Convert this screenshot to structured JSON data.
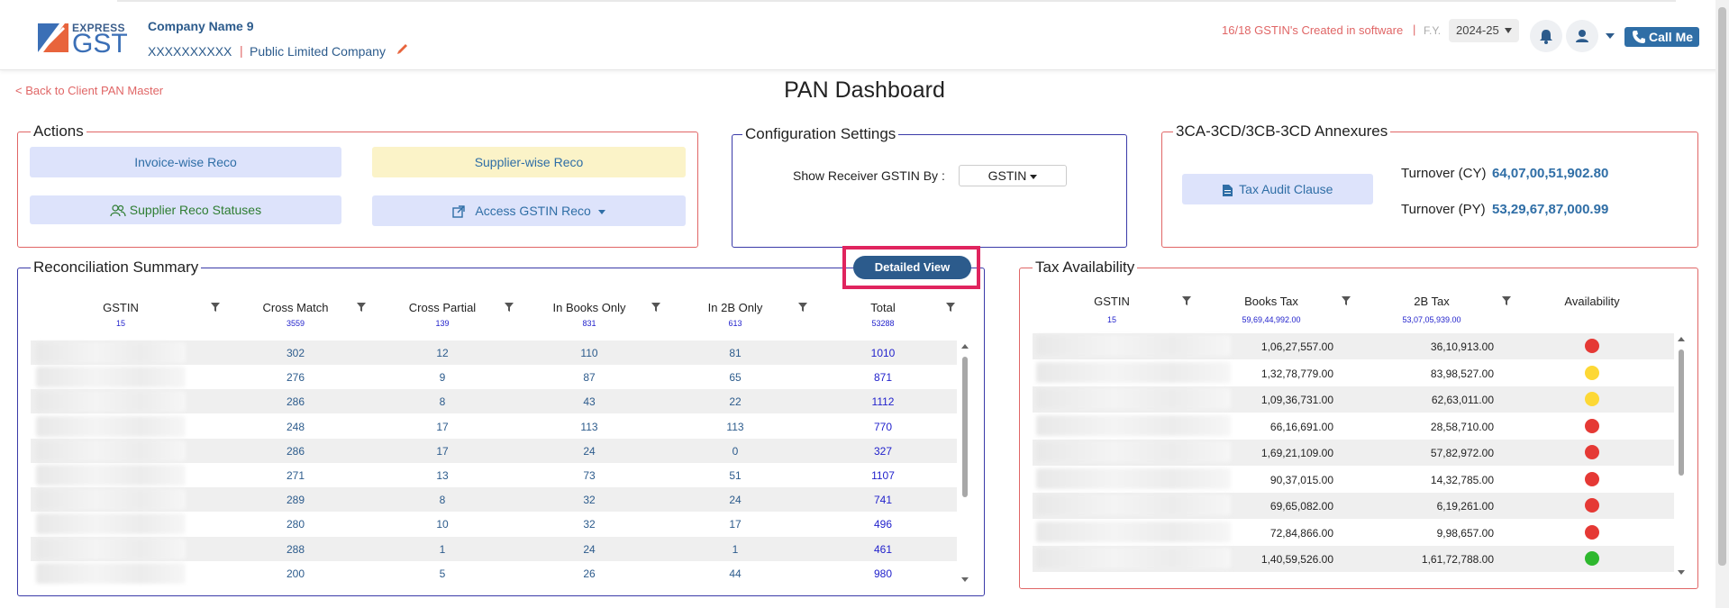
{
  "header": {
    "logo_top": "EXPRESS",
    "logo_bottom": "GST",
    "company_name": "Company Name 9",
    "pan": "XXXXXXXXXX",
    "separator": "|",
    "company_type": "Public Limited Company",
    "gstin_created": "16/18 GSTIN's Created in software",
    "fy_label": "F.Y.",
    "fy_value": "2024-25",
    "call_me": "Call Me"
  },
  "nav": {
    "back_link": "< Back to Client PAN Master",
    "page_title": "PAN Dashboard"
  },
  "actions": {
    "legend": "Actions",
    "invoice_reco": "Invoice-wise Reco",
    "supplier_reco": "Supplier-wise Reco",
    "supplier_statuses": "Supplier Reco Statuses",
    "access_gstin_reco": "Access GSTIN Reco"
  },
  "config": {
    "legend": "Configuration Settings",
    "label": "Show Receiver GSTIN By :",
    "value": "GSTIN"
  },
  "annexures": {
    "legend": "3CA-3CD/3CB-3CD Annexures",
    "tax_audit": "Tax Audit Clause",
    "turnover_cy_label": "Turnover (CY)",
    "turnover_cy": "64,07,00,51,902.80",
    "turnover_py_label": "Turnover (PY)",
    "turnover_py": "53,29,67,87,000.99"
  },
  "reco": {
    "legend": "Reconciliation Summary",
    "detailed_view": "Detailed View",
    "columns": [
      "GSTIN",
      "Cross Match",
      "Cross Partial",
      "In Books Only",
      "In 2B Only",
      "Total"
    ],
    "totals": [
      "15",
      "3559",
      "139",
      "831",
      "613",
      "53288"
    ],
    "rows": [
      [
        "302",
        "12",
        "110",
        "81",
        "1010"
      ],
      [
        "276",
        "9",
        "87",
        "65",
        "871"
      ],
      [
        "286",
        "8",
        "43",
        "22",
        "1112"
      ],
      [
        "248",
        "17",
        "113",
        "113",
        "770"
      ],
      [
        "286",
        "17",
        "24",
        "0",
        "327"
      ],
      [
        "271",
        "13",
        "73",
        "51",
        "1107"
      ],
      [
        "289",
        "8",
        "32",
        "24",
        "741"
      ],
      [
        "280",
        "10",
        "32",
        "17",
        "496"
      ],
      [
        "288",
        "1",
        "24",
        "1",
        "461"
      ],
      [
        "200",
        "5",
        "26",
        "44",
        "980"
      ]
    ]
  },
  "tax": {
    "legend": "Tax Availability",
    "columns": [
      "GSTIN",
      "Books Tax",
      "2B Tax",
      "Availability"
    ],
    "totals": [
      "15",
      "59,69,44,992.00",
      "53,07,05,939.00"
    ],
    "rows": [
      [
        "1,06,27,557.00",
        "36,10,913.00",
        "red"
      ],
      [
        "1,32,78,779.00",
        "83,98,527.00",
        "yellow"
      ],
      [
        "1,09,36,731.00",
        "62,63,011.00",
        "yellow"
      ],
      [
        "66,16,691.00",
        "28,58,710.00",
        "red"
      ],
      [
        "1,69,21,109.00",
        "57,82,972.00",
        "red"
      ],
      [
        "90,37,015.00",
        "14,32,785.00",
        "red"
      ],
      [
        "69,65,082.00",
        "6,19,261.00",
        "red"
      ],
      [
        "72,84,866.00",
        "9,98,657.00",
        "red"
      ],
      [
        "1,40,59,526.00",
        "1,61,72,788.00",
        "green"
      ]
    ],
    "colors": {
      "red": "#e53935",
      "yellow": "#fdd835",
      "green": "#2eb82e"
    }
  }
}
